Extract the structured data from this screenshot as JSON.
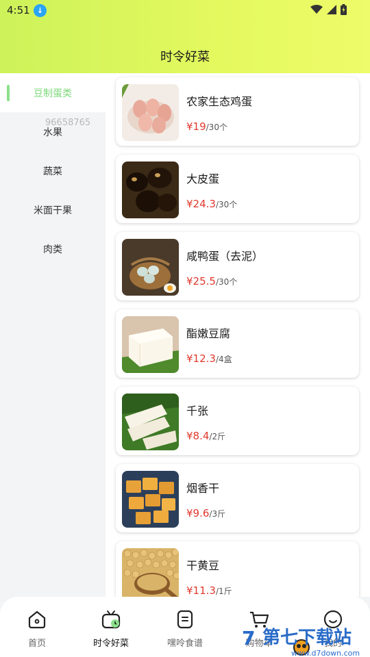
{
  "status": {
    "time": "4:51"
  },
  "header": {
    "title": "时令好菜"
  },
  "sidebar": {
    "items": [
      {
        "label": "豆制蛋类",
        "active": true
      },
      {
        "label": "水果"
      },
      {
        "label": "蔬菜"
      },
      {
        "label": "米面干果"
      },
      {
        "label": "肉类"
      }
    ],
    "overlay_number": "96658765"
  },
  "products": [
    {
      "name": "农家生态鸡蛋",
      "price": "¥19",
      "unit": "/30个",
      "icon": "eggs-photo"
    },
    {
      "name": "大皮蛋",
      "price": "¥24.3",
      "unit": "/30个",
      "icon": "century-egg-photo"
    },
    {
      "name": "咸鸭蛋（去泥）",
      "price": "¥25.5",
      "unit": "/30个",
      "icon": "salted-duck-egg-photo"
    },
    {
      "name": "酯嫩豆腐",
      "price": "¥12.3",
      "unit": "/4盒",
      "icon": "tofu-photo"
    },
    {
      "name": "千张",
      "price": "¥8.4",
      "unit": "/2斤",
      "icon": "tofu-skin-photo"
    },
    {
      "name": "烟香干",
      "price": "¥9.6",
      "unit": "/3斤",
      "icon": "smoked-tofu-photo"
    },
    {
      "name": "干黄豆",
      "price": "¥11.3",
      "unit": "/1斤",
      "icon": "soybeans-photo"
    }
  ],
  "tabbar": {
    "tabs": [
      {
        "label": "首页",
        "icon": "home-icon"
      },
      {
        "label": "时令好菜",
        "icon": "tv-icon",
        "active": true
      },
      {
        "label": "嘿呤食谱",
        "icon": "recipe-icon"
      },
      {
        "label": "购物车",
        "icon": "cart-icon"
      },
      {
        "label": "我的",
        "icon": "smile-icon"
      }
    ]
  },
  "watermark": {
    "text": "第七下载站",
    "url": "www.d7down.com"
  },
  "colors": {
    "accent": "#8be08a",
    "price": "#e0392d",
    "header_gradient_start": "#cdf25a",
    "header_gradient_end": "#eefb6a"
  }
}
